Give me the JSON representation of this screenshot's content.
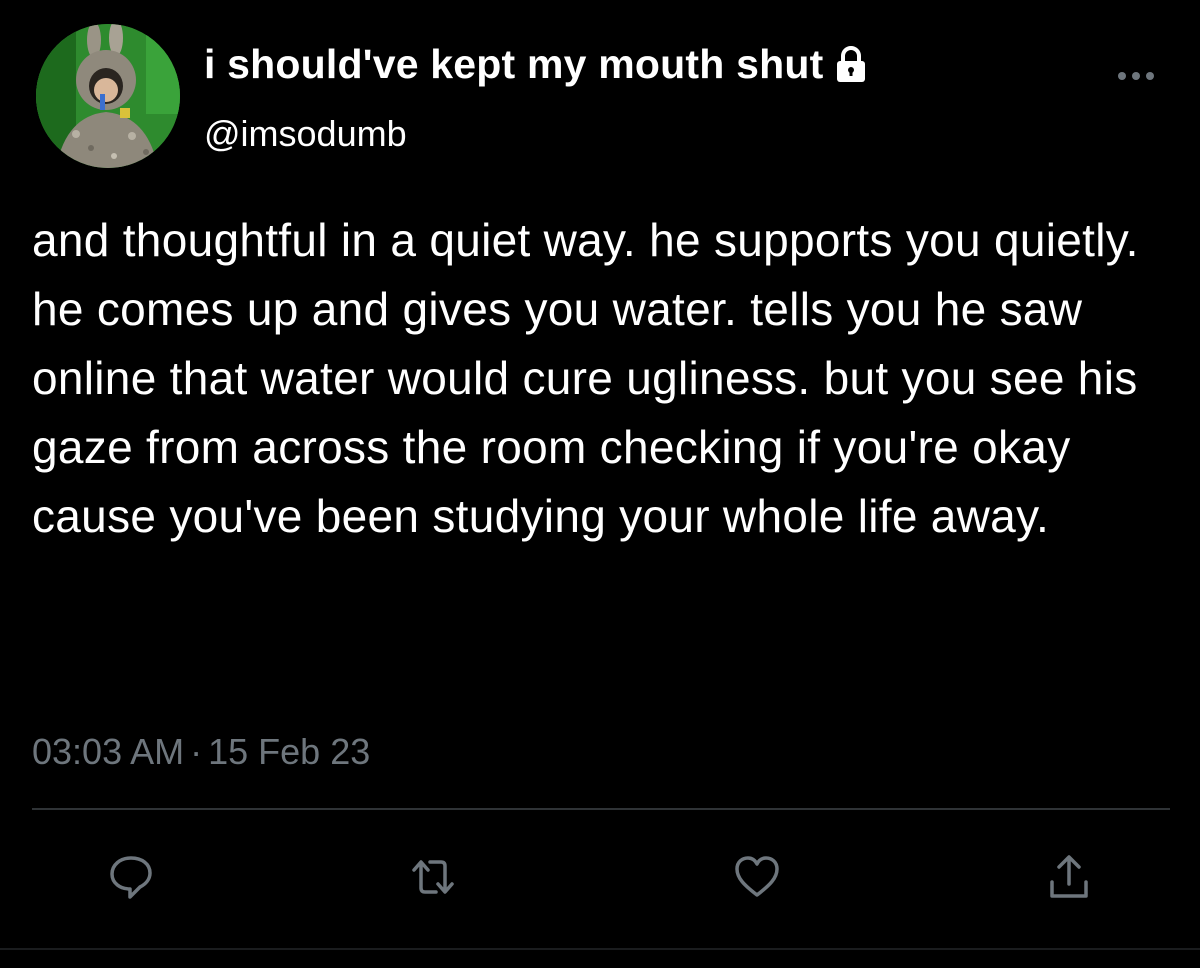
{
  "user": {
    "display_name": "i should've kept my mouth shut",
    "handle": "@imsodumb",
    "avatar": "avatar-photo",
    "protected_icon": "lock-icon"
  },
  "menu_icon": "more-icon",
  "tweet": {
    "text": "and thoughtful in a quiet way. he supports you quietly. he comes up and gives you water. tells you he saw online that water would cure ugliness. but you see his gaze from across the room checking if you're okay cause you've been studying your whole life away.",
    "time": "03:03 AM",
    "separator": "·",
    "date": "15 Feb 23"
  },
  "actions": [
    {
      "icon": "reply-icon"
    },
    {
      "icon": "retweet-icon"
    },
    {
      "icon": "like-icon"
    },
    {
      "icon": "share-icon"
    }
  ],
  "colors": {
    "background": "#000000",
    "text": "#ffffff",
    "secondary_text": "#6e767d",
    "divider": "#2f3336"
  }
}
